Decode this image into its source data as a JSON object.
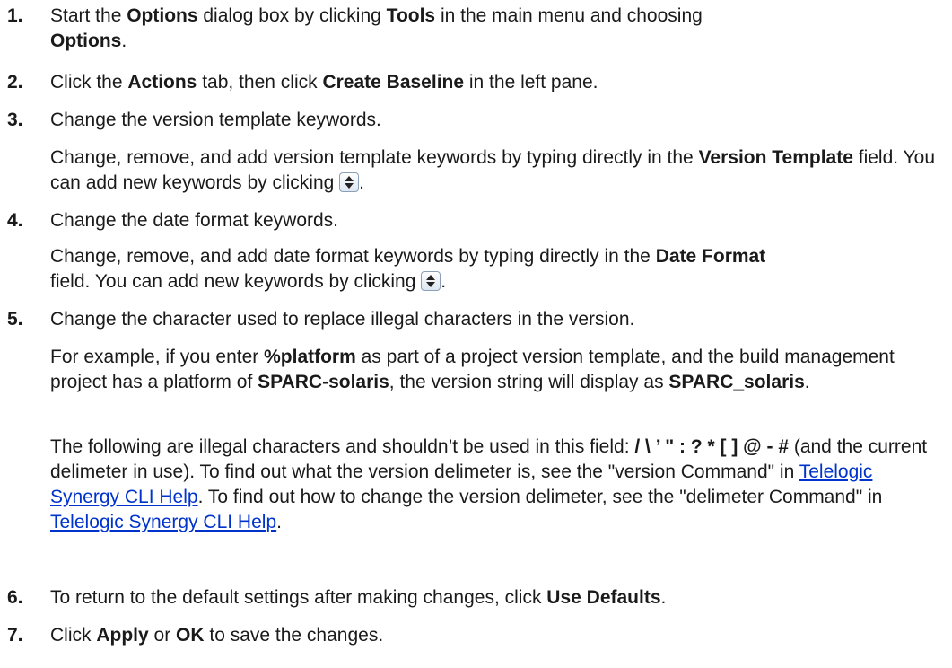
{
  "steps": [
    {
      "number": "1.",
      "t1": "Start the ",
      "b1": "Options",
      "t2": " dialog box by clicking ",
      "b2": "Tools",
      "t3": " in the main menu and choosing ",
      "b3": "Options",
      "t4": "."
    },
    {
      "number": "2.",
      "t1": "Click the ",
      "b1": "Actions",
      "t2": " tab, then click ",
      "b2": "Create Baseline",
      "t3": " in the left pane."
    },
    {
      "number": "3.",
      "text": "Change the version template keywords.",
      "d1": "Change, remove, and add version template keywords by typing directly in the ",
      "db1": "Version Template",
      "d2": " field. You can add new keywords by clicking ",
      "d3": "."
    },
    {
      "number": "4.",
      "text": "Change the date format keywords.",
      "d1": "Change, remove, and add date format keywords by typing directly in the ",
      "db1": "Date Format",
      "d2": " field. You can add new keywords by clicking ",
      "d3": "."
    },
    {
      "number": "5.",
      "text": "Change the character used to replace illegal characters in the version.",
      "p1": {
        "t1": "For example, if you enter ",
        "b1": "%platform",
        "t2": " as part of a project version template, and the build management project has a platform of ",
        "b2": "SPARC-solaris",
        "t3": ", the version string will display as ",
        "b3": "SPARC_solaris",
        "t4": "."
      },
      "p2": {
        "t1": "The following are illegal characters and shouldn’t be used in this field: ",
        "b1": "/ \\ ’ \" : ? * [ ] @ - #",
        "t2": " (and the current delimeter in use). To find out what the version delimeter is, see the \"version Command\" in ",
        "link1": "Telelogic Synergy CLI Help",
        "t3": ". To find out how to change the version delimeter, see the \"delimeter Command\" in ",
        "link2": "Telelogic Synergy CLI Help",
        "t4": "."
      }
    },
    {
      "number": "6.",
      "t1": "To return to the default settings after making changes, click ",
      "b1": "Use Defaults",
      "t2": "."
    },
    {
      "number": "7.",
      "t1": "Click ",
      "b1": "Apply",
      "t2": " or ",
      "b2": "OK",
      "t3": " to save the changes."
    }
  ],
  "icons": {
    "spinner": "up-down-spinner-icon"
  }
}
